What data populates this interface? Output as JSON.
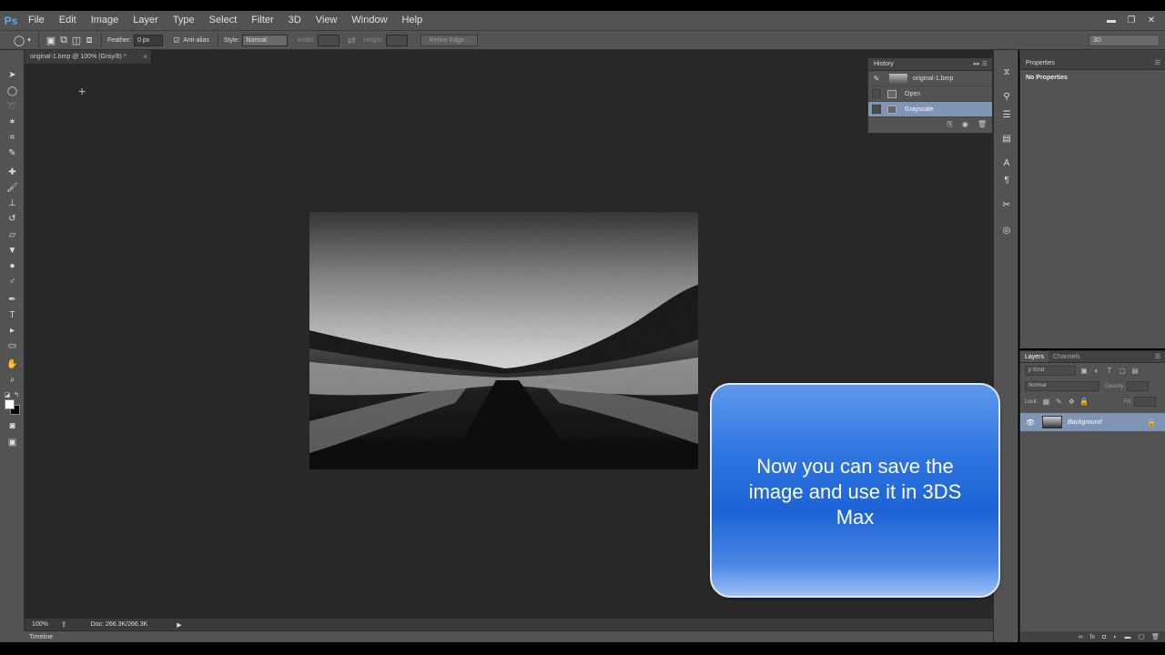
{
  "app": {
    "logo": "Ps"
  },
  "menu": [
    "File",
    "Edit",
    "Image",
    "Layer",
    "Type",
    "Select",
    "Filter",
    "3D",
    "View",
    "Window",
    "Help"
  ],
  "window_controls": {
    "minimize": "▬",
    "restore": "❐",
    "close": "✕"
  },
  "options": {
    "feather_label": "Feather:",
    "feather_value": "0 px",
    "antialias_label": "Anti-alias",
    "style_label": "Style:",
    "style_value": "Normal",
    "width_label": "Width:",
    "height_label": "Height:",
    "refine_edge": "Refine Edge...",
    "workspace": "3D"
  },
  "document": {
    "tab_title": "original-1.bmp @ 100% (Gray/8) *",
    "close": "×"
  },
  "status": {
    "zoom": "100%",
    "doc_info": "Doc: 266.3K/266.3K"
  },
  "timeline": {
    "label": "Timeline"
  },
  "history": {
    "title": "History",
    "snapshot": "original-1.bmp",
    "items": [
      {
        "label": "Open"
      },
      {
        "label": "Grayscale"
      }
    ]
  },
  "properties": {
    "title": "Properties",
    "body": "No Properties"
  },
  "layers": {
    "tabs": [
      "Layers",
      "Channels"
    ],
    "kind_filter": "ρ Kind",
    "blend_mode": "Normal",
    "opacity_label": "Opacity:",
    "lock_label": "Lock:",
    "fill_label": "Fill:",
    "layer_name": "Background"
  },
  "callout": {
    "text": "Now you can save the image and use it in 3DS Max"
  },
  "colors": {
    "panel": "#535353",
    "workspace": "#282828",
    "selection": "#7e95b5",
    "callout_blue": "#2d74e0"
  }
}
